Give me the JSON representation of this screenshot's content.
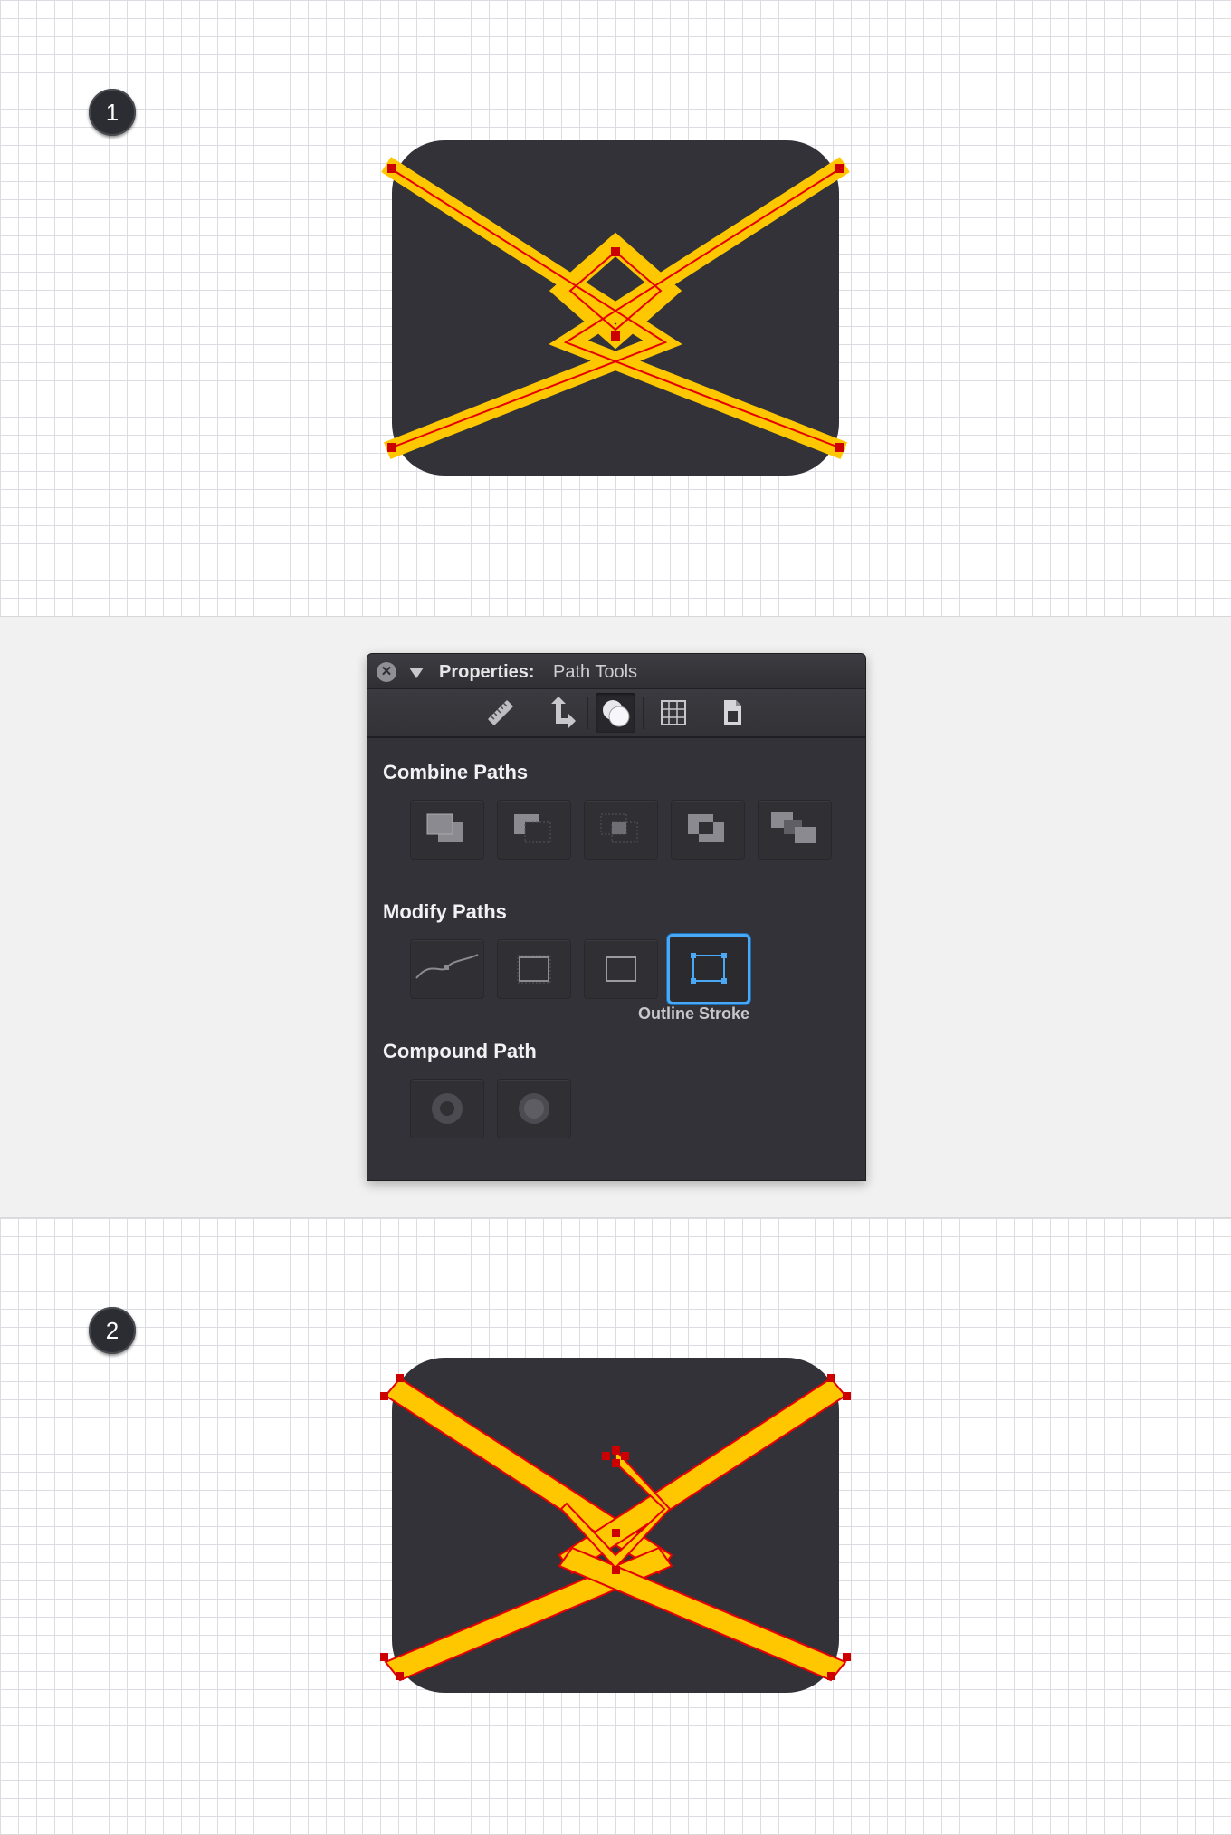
{
  "steps": {
    "first": {
      "number": "1"
    },
    "second": {
      "number": "2"
    }
  },
  "colors": {
    "envelope": "#333238",
    "stroke": "#ffc700",
    "anchor": "#cc0000",
    "path_line": "#e60000",
    "selection": "#4aa8f5"
  },
  "properties_panel": {
    "title_label": "Properties:",
    "title_value": "Path Tools",
    "toolbar_icons": [
      "ruler-icon",
      "transform-arrows-icon",
      "path-ops-circles-icon",
      "grid-icon",
      "document-icon"
    ],
    "active_toolbar_icon": "path-ops-circles-icon",
    "sections": {
      "combine": {
        "title": "Combine Paths",
        "buttons": [
          "unite-icon",
          "subtract-icon",
          "intersect-icon",
          "exclude-icon",
          "divide-icon"
        ]
      },
      "modify": {
        "title": "Modify Paths",
        "buttons": [
          "simplify-path-icon",
          "expand-icon",
          "reverse-path-icon",
          "outline-stroke-icon"
        ],
        "selected": "outline-stroke-icon",
        "tooltip": "Outline Stroke"
      },
      "compound": {
        "title": "Compound Path",
        "buttons": [
          "make-compound-icon",
          "release-compound-icon"
        ]
      }
    }
  }
}
